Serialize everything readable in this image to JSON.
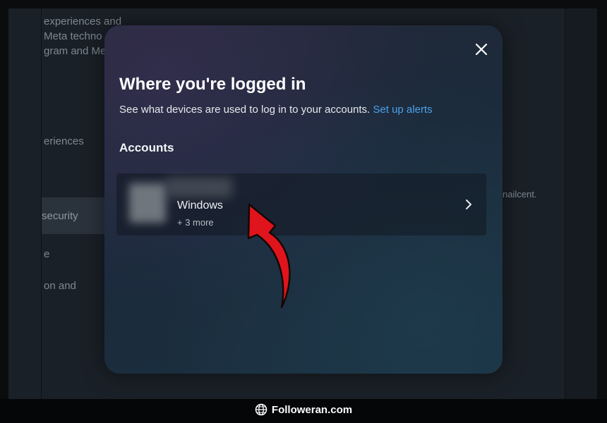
{
  "background": {
    "fragments": [
      {
        "id": "bg-text-1",
        "text": "experiences and"
      },
      {
        "id": "bg-text-2",
        "text": "Meta techno"
      },
      {
        "id": "bg-text-3",
        "text": "gram and Me"
      },
      {
        "id": "bg-text-4",
        "text": "eriences"
      },
      {
        "id": "bg-text-5",
        "text": "security"
      },
      {
        "id": "bg-text-6",
        "text": "e"
      },
      {
        "id": "bg-text-7",
        "text": "on and"
      },
      {
        "id": "bg-text-8",
        "text": "nailcent."
      }
    ]
  },
  "modal": {
    "title": "Where you're logged in",
    "description": "See what devices are used to log in to your accounts.",
    "alerts_link": "Set up alerts",
    "section_heading": "Accounts",
    "close_icon": "close-icon",
    "account": {
      "device": "Windows",
      "more": "+ 3 more",
      "chevron_icon": "chevron-right-icon"
    }
  },
  "annotation": {
    "arrow_icon": "red-curved-arrow",
    "color": "#e0141c"
  },
  "footer": {
    "brand": "Followeran.com",
    "icon": "globe-icon"
  }
}
